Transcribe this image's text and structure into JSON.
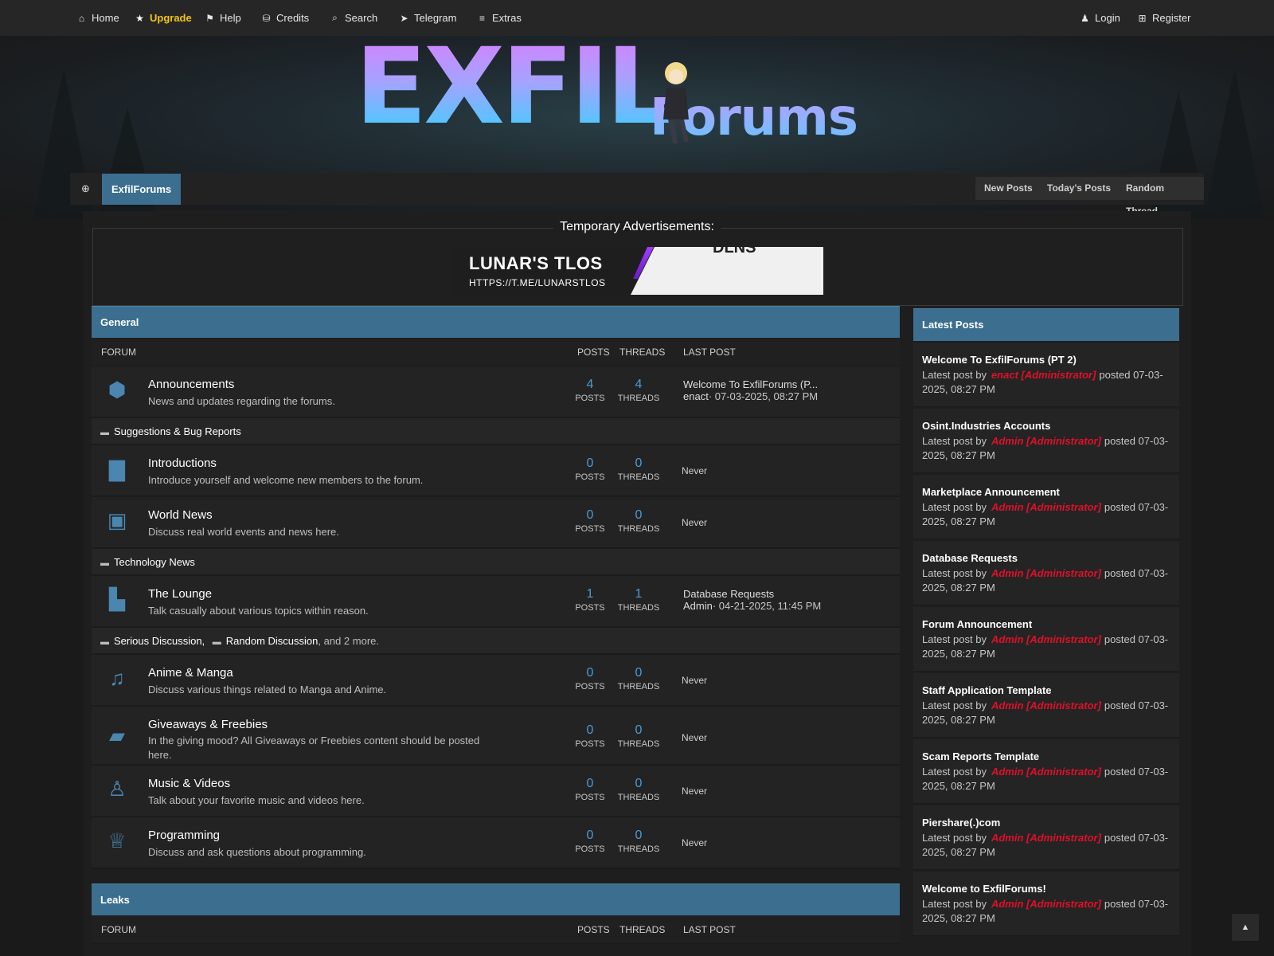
{
  "nav": {
    "home": "Home",
    "upgrade": "Upgrade",
    "help": "Help",
    "credits": "Credits",
    "search": "Search",
    "telegram": "Telegram",
    "extras": "Extras",
    "login": "Login",
    "register": "Register"
  },
  "logo": {
    "big": "EXFIL",
    "small": "Forums"
  },
  "breadcrumb": {
    "current": "ExfilForums"
  },
  "quick": {
    "new_posts": "New Posts",
    "todays_posts": "Today's Posts",
    "random_thread": "Random Thread"
  },
  "ads": {
    "title": "Temporary Advertisements:",
    "banner_title": "LUNAR'S TLOS",
    "banner_url": "HTTPS://T.ME/LUNARSTLOS",
    "banner_right": "DLNS"
  },
  "general": {
    "title": "General",
    "col_forum": "FORUM",
    "col_posts": "POSTS",
    "col_threads": "THREADS",
    "col_last": "LAST POST",
    "posts_label": "POSTS",
    "threads_label": "THREADS",
    "never": "Never",
    "announcements": {
      "title": "Announcements",
      "desc": "News and updates regarding the forums.",
      "posts": "4",
      "threads": "4",
      "last_title": "Welcome To ExfilForums (P...",
      "last_user": "enact",
      "last_date": "· 07-03-2025, 08:27 PM"
    },
    "sub1": "Suggestions & Bug Reports",
    "introductions": {
      "title": "Introductions",
      "desc": "Introduce yourself and welcome new members to the forum.",
      "posts": "0",
      "threads": "0"
    },
    "world_news": {
      "title": "World News",
      "desc": "Discuss real world events and news here.",
      "posts": "0",
      "threads": "0"
    },
    "sub2": "Technology News",
    "lounge": {
      "title": "The Lounge",
      "desc": "Talk casually about various topics within reason.",
      "posts": "1",
      "threads": "1",
      "last_title": "Database Requests",
      "last_user": "Admin",
      "last_date": "· 04-21-2025, 11:45 PM"
    },
    "sub3a": "Serious Discussion",
    "sub3b": "Random Discussion",
    "sub3more": ", and 2 more.",
    "anime": {
      "title": "Anime & Manga",
      "desc": "Discuss various things related to Manga and Anime.",
      "posts": "0",
      "threads": "0"
    },
    "giveaways": {
      "title": "Giveaways & Freebies",
      "desc": "In the giving mood? All Giveaways or Freebies content should be posted here.",
      "posts": "0",
      "threads": "0"
    },
    "music": {
      "title": "Music & Videos",
      "desc": "Talk about your favorite music and videos here.",
      "posts": "0",
      "threads": "0"
    },
    "programming": {
      "title": "Programming",
      "desc": "Discuss and ask questions about programming.",
      "posts": "0",
      "threads": "0"
    }
  },
  "leaks": {
    "title": "Leaks"
  },
  "latest": {
    "title": "Latest Posts",
    "prefix": "Latest post by",
    "items": [
      {
        "title": "Welcome To ExfilForums (PT 2)",
        "author": "enact [Administrator]",
        "posted": "posted 07-03-2025, 08:27 PM"
      },
      {
        "title": "Osint.Industries Accounts",
        "author": "Admin [Administrator]",
        "posted": "posted 07-03-2025, 08:27 PM"
      },
      {
        "title": "Marketplace Announcement",
        "author": "Admin [Administrator]",
        "posted": "posted 07-03-2025, 08:27 PM"
      },
      {
        "title": "Database Requests",
        "author": "Admin [Administrator]",
        "posted": "posted 07-03-2025, 08:27 PM"
      },
      {
        "title": "Forum Announcement",
        "author": "Admin [Administrator]",
        "posted": "posted 07-03-2025, 08:27 PM"
      },
      {
        "title": "Staff Application Template",
        "author": "Admin [Administrator]",
        "posted": "posted 07-03-2025, 08:27 PM"
      },
      {
        "title": "Scam Reports Template",
        "author": "Admin [Administrator]",
        "posted": "posted 07-03-2025, 08:27 PM"
      },
      {
        "title": "Piershare(.)com",
        "author": "Admin [Administrator]",
        "posted": "posted 07-03-2025, 08:27 PM"
      },
      {
        "title": "Welcome to ExfilForums!",
        "author": "Admin [Administrator]",
        "posted": "posted 07-03-2025, 08:27 PM"
      }
    ]
  },
  "colors": {
    "accent": "#3b6e8f",
    "link": "#4a9bd6",
    "admin": "#e0102a",
    "upgrade": "#f3c317"
  }
}
